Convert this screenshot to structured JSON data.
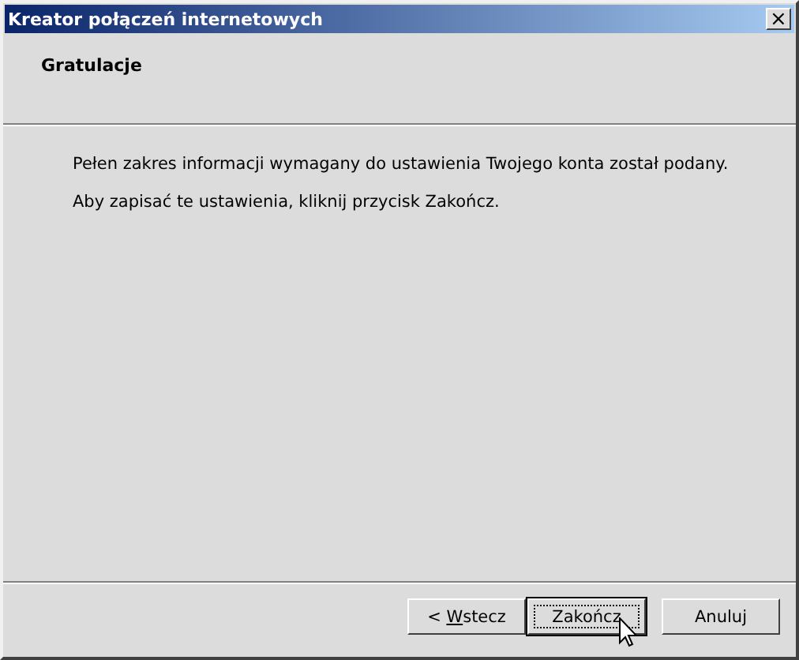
{
  "window": {
    "title": "Kreator połączeń internetowych",
    "close_button": "×"
  },
  "header": {
    "title": "Gratulacje"
  },
  "body": {
    "paragraphs": [
      "Pełen zakres informacji wymagany do ustawienia Twojego konta został podany.",
      "Aby zapisać te ustawienia, kliknij przycisk Zakończ."
    ]
  },
  "buttons": [
    {
      "label_parts": [
        {
          "text": "< ",
          "underlined": false
        },
        {
          "text": "W",
          "underlined": true
        },
        {
          "text": "stecz",
          "underlined": false
        }
      ],
      "default": false
    },
    {
      "label_parts": [
        {
          "text": "Zakończ",
          "underlined": false
        }
      ],
      "default": true
    },
    {
      "label_parts": [
        {
          "text": "Anuluj",
          "underlined": false
        }
      ],
      "default": false
    }
  ]
}
